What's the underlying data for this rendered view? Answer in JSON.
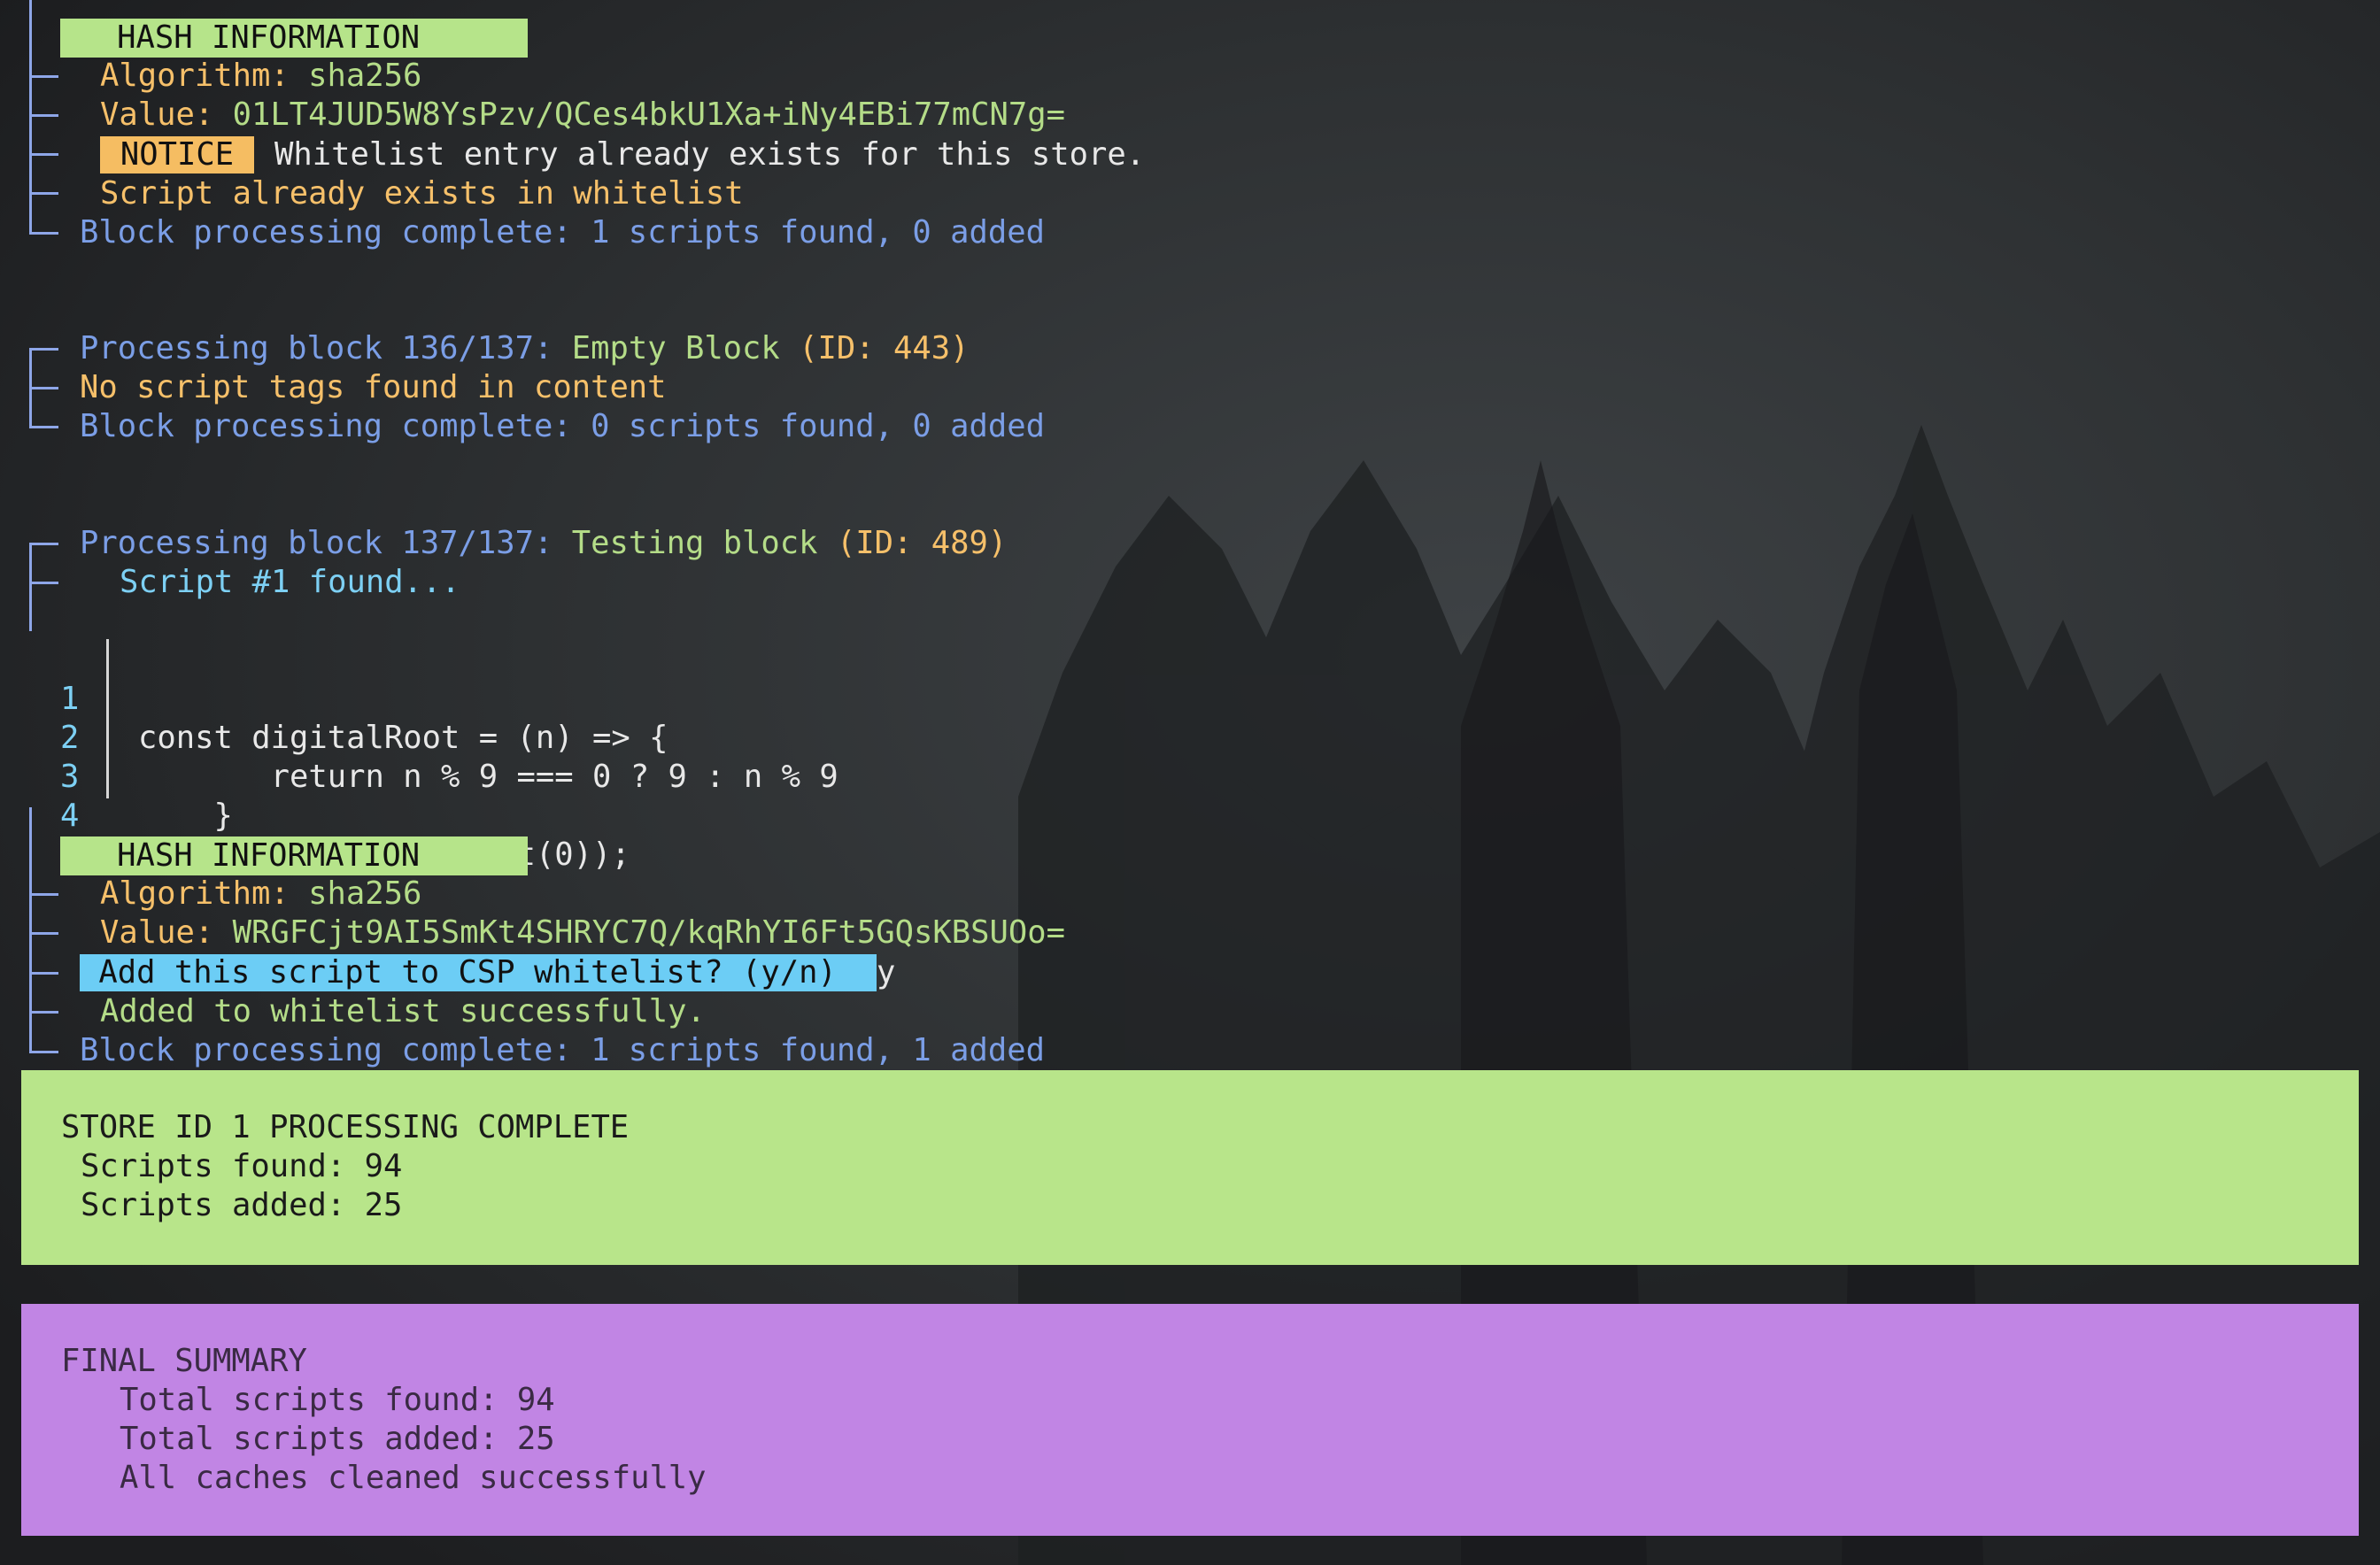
{
  "block1": {
    "hash_header": "HASH INFORMATION",
    "algorithm_label": "Algorithm: ",
    "algorithm_value": "sha256",
    "value_label": "Value: ",
    "value_hash": "01LT4JUD5W8YsPzv/QCes4bkU1Xa+iNy4EBi77mCN7g=",
    "notice_badge": "NOTICE",
    "notice_text": "Whitelist entry already exists for this store.",
    "already_exists": "Script already exists in whitelist",
    "complete": "Block processing complete: 1 scripts found, 0 added"
  },
  "block2": {
    "processing_prefix": "Processing block 136/137: ",
    "block_name": "Empty Block ",
    "block_id": "(ID: 443)",
    "no_scripts": "No script tags found in content",
    "complete": "Block processing complete: 0 scripts found, 0 added"
  },
  "block3": {
    "processing_prefix": "Processing block 137/137: ",
    "block_name": "Testing block ",
    "block_id": "(ID: 489)",
    "script_found": "Script #1 found...",
    "code_lines": [
      {
        "num": "1",
        "code": "const digitalRoot = (n) => {"
      },
      {
        "num": "2",
        "code": "       return n % 9 === 0 ? 9 : n % 9"
      },
      {
        "num": "3",
        "code": "    }"
      },
      {
        "num": "4",
        "code": "    alert(digitalRoot(0));"
      }
    ],
    "hash_header": "HASH INFORMATION",
    "algorithm_label": "Algorithm: ",
    "algorithm_value": "sha256",
    "value_label": "Value: ",
    "value_hash": "WRGFCjt9AI5SmKt4SHRYC7Q/kqRhYI6Ft5GQsKBSUOo=",
    "prompt": "Add this script to CSP whitelist? (y/n) ",
    "prompt_answer": "y",
    "added": "Added to whitelist successfully.",
    "complete": "Block processing complete: 1 scripts found, 1 added"
  },
  "store_panel": {
    "title": "STORE ID 1 PROCESSING COMPLETE",
    "scripts_found": "Scripts found: 94",
    "scripts_added": "Scripts added: 25"
  },
  "final_panel": {
    "title": "FINAL SUMMARY",
    "total_found": "Total scripts found: 94",
    "total_added": "Total scripts added: 25",
    "caches": "All caches cleaned successfully"
  },
  "colors": {
    "tree": "#8ea6e8",
    "blue_text": "#7b9ee6",
    "orange_text": "#f6c06a",
    "green_text": "#b4dc88",
    "cyan_text": "#7dd0f4",
    "green_panel": "#b8e58a",
    "purple_panel": "#c185e4",
    "notice_badge": "#f5bd62",
    "prompt_highlight": "#6ccdf5"
  }
}
